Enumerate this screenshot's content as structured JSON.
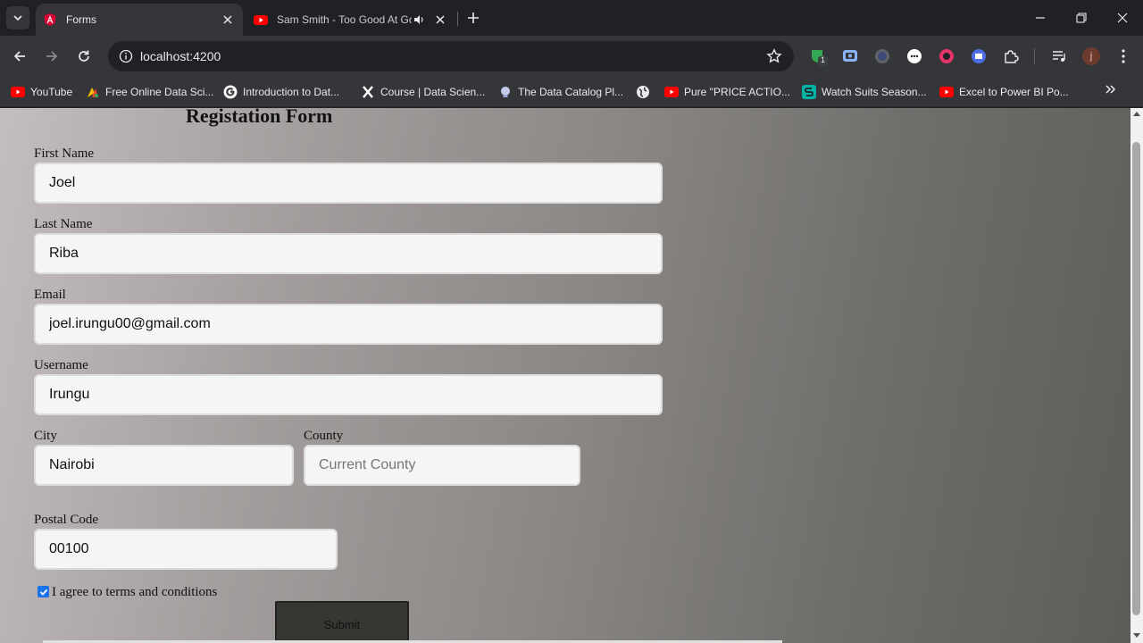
{
  "browser": {
    "tabs": [
      {
        "title": "Forms",
        "favicon": "angular-icon",
        "active": true
      },
      {
        "title": "Sam Smith - Too Good At Goodbyes",
        "favicon": "youtube-icon",
        "active": false,
        "audio": true
      }
    ],
    "address": "localhost:4200",
    "profile_initial": "j",
    "extension_badge": "1",
    "bookmarks": [
      {
        "label": "YouTube",
        "icon": "youtube-icon"
      },
      {
        "label": "Free Online Data Sci...",
        "icon": "colorful-icon"
      },
      {
        "label": "Introduction to Dat...",
        "icon": "google-icon"
      },
      {
        "label": "Course | Data Scien...",
        "icon": "x-icon"
      },
      {
        "label": "The Data Catalog Pl...",
        "icon": "catalog-icon"
      },
      {
        "label": "",
        "icon": "globe-icon"
      },
      {
        "label": "Pure \"PRICE ACTIO...",
        "icon": "youtube-icon"
      },
      {
        "label": "Watch Suits Season...",
        "icon": "s-icon"
      },
      {
        "label": "Excel to Power BI Po...",
        "icon": "youtube-icon"
      }
    ]
  },
  "form": {
    "title": "Registation Form",
    "first_name": {
      "label": "First Name",
      "value": "Joel"
    },
    "last_name": {
      "label": "Last Name",
      "value": "Riba"
    },
    "email": {
      "label": "Email",
      "value": "joel.irungu00@gmail.com"
    },
    "username": {
      "label": "Username",
      "value": "Irungu"
    },
    "city": {
      "label": "City",
      "value": "Nairobi"
    },
    "county": {
      "label": "County",
      "value": "",
      "placeholder": "Current County"
    },
    "postal_code": {
      "label": "Postal Code",
      "value": "00100"
    },
    "terms": {
      "label": "I agree to terms and conditions",
      "checked": true
    },
    "submit_label": "Submit"
  },
  "colors": {
    "accent": "#1a73e8",
    "youtube_red": "#ff0000",
    "angular_red": "#dd0031",
    "submit_bg": "#363633"
  }
}
